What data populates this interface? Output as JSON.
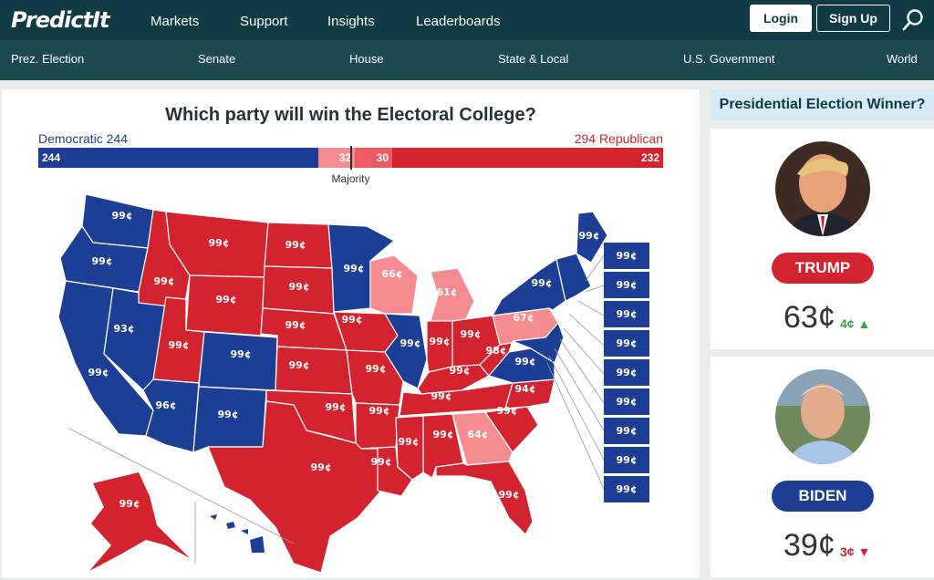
{
  "header": {
    "logo": "PredictIt",
    "nav": [
      "Markets",
      "Support",
      "Insights",
      "Leaderboards"
    ],
    "login_label": "Login",
    "signup_label": "Sign Up"
  },
  "categories": [
    "Prez. Election",
    "Senate",
    "House",
    "State & Local",
    "U.S. Government",
    "World"
  ],
  "market": {
    "question": "Which party will win the Electoral College?",
    "dem_label": "Democratic 244",
    "rep_label": "294 Republican",
    "bar": {
      "dem_safe": "244",
      "dem_lean": "32",
      "rep_lean": "30",
      "rep_safe": "232"
    },
    "majority_label": "Majority"
  },
  "colors": {
    "dem": "#1d3e95",
    "dem_lean": "#f48c91",
    "rep_lean": "#ec5a62",
    "rep": "#d2232e"
  },
  "map": {
    "states": {
      "WA": "99¢",
      "OR": "99¢",
      "CA": "99¢",
      "NV": "93¢",
      "ID": "99¢",
      "MT": "99¢",
      "WY": "99¢",
      "UT": "99¢",
      "AZ": "96¢",
      "CO": "99¢",
      "NM": "99¢",
      "ND": "99¢",
      "SD": "99¢",
      "NE": "99¢",
      "KS": "99¢",
      "OK": "99¢",
      "TX": "99¢",
      "MN": "99¢",
      "IA": "99¢",
      "MO": "99¢",
      "AR": "99¢",
      "LA": "99¢",
      "WI": "66¢",
      "IL": "99¢",
      "MI": "61¢",
      "IN": "99¢",
      "OH": "99¢",
      "KY": "99¢",
      "TN": "99¢",
      "MS": "99¢",
      "AL": "99¢",
      "GA": "64¢",
      "FL": "99¢",
      "SC": "99¢",
      "NC": "94¢",
      "VA": "99¢",
      "WV": "98¢",
      "PA": "67¢",
      "NY": "99¢",
      "ME": "99¢",
      "AK": "99¢"
    },
    "east_boxes": [
      "99¢",
      "99¢",
      "99¢",
      "99¢",
      "99¢",
      "99¢",
      "99¢",
      "99¢",
      "99¢"
    ]
  },
  "sidebar": {
    "title": "Presidential Election Winner?",
    "candidates": [
      {
        "name": "TRUMP",
        "price": "63¢",
        "change": "4¢",
        "direction": "up"
      },
      {
        "name": "BIDEN",
        "price": "39¢",
        "change": "3¢",
        "direction": "down"
      }
    ]
  }
}
